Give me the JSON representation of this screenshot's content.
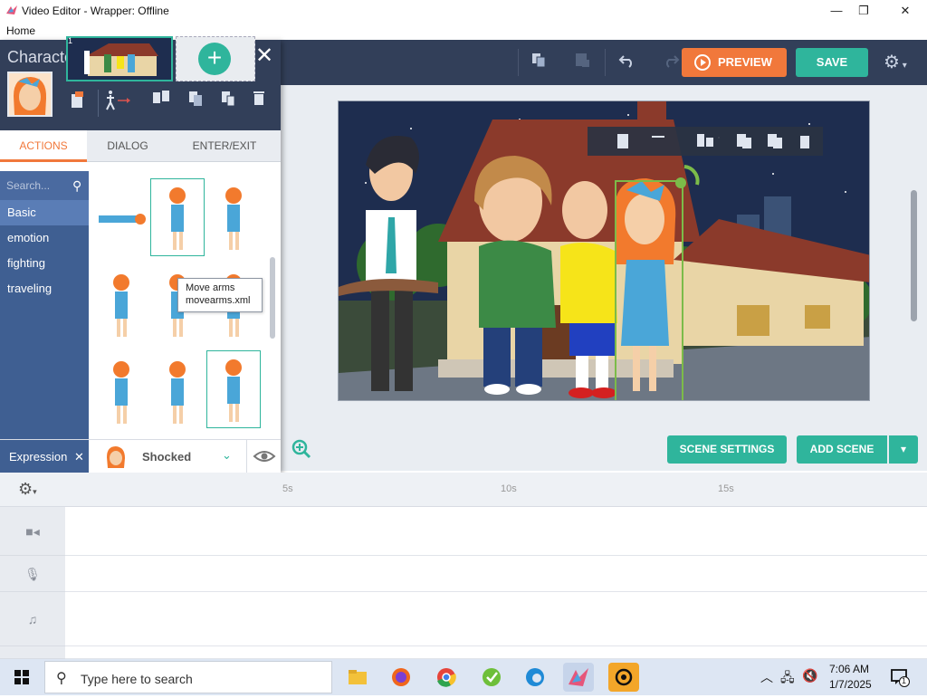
{
  "window": {
    "title": "Video Editor - Wrapper: Offline",
    "minimize": "—",
    "maximize": "❐",
    "close": "✕",
    "menu": "Home"
  },
  "toolbar": {
    "preview_label": "PREVIEW",
    "save_label": "SAVE"
  },
  "character_panel": {
    "title": "Character Settings",
    "tabs": [
      "ACTIONS",
      "DIALOG",
      "ENTER/EXIT"
    ],
    "search_placeholder": "Search...",
    "categories": [
      "Basic",
      "emotion",
      "fighting",
      "traveling"
    ],
    "tooltip": {
      "line1": "Move arms",
      "line2": "movearms.xml"
    },
    "expression_label": "Expression",
    "expression_value": "Shocked"
  },
  "stage": {
    "scene_settings_label": "SCENE SETTINGS",
    "add_scene_label": "ADD SCENE"
  },
  "timeline": {
    "ruler": [
      "5s",
      "10s",
      "15s"
    ],
    "scene_number": "1"
  },
  "taskbar": {
    "search_placeholder": "Type here to search",
    "time": "7:06 AM",
    "date": "1/7/2025",
    "notification_count": "1"
  },
  "colors": {
    "accent_orange": "#f1783b",
    "accent_teal": "#2fb59c",
    "header_navy": "#323f59",
    "category_blue": "#3f5f92"
  }
}
